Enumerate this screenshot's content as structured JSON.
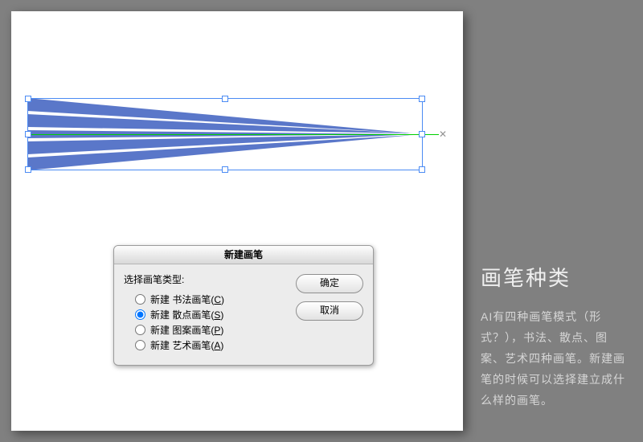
{
  "colors": {
    "shape_fill": "#5a77c9",
    "selection": "#4b8bf4",
    "axis": "#00d000"
  },
  "dialog": {
    "title": "新建画笔",
    "prompt": "选择画笔类型:",
    "options": [
      {
        "label_prefix": "新建 书法画笔(",
        "hotkey": "C",
        "label_suffix": ")",
        "selected": false
      },
      {
        "label_prefix": "新建 散点画笔(",
        "hotkey": "S",
        "label_suffix": ")",
        "selected": true
      },
      {
        "label_prefix": "新建 图案画笔(",
        "hotkey": "P",
        "label_suffix": ")",
        "selected": false
      },
      {
        "label_prefix": "新建 艺术画笔(",
        "hotkey": "A",
        "label_suffix": ")",
        "selected": false
      }
    ],
    "buttons": {
      "ok": "确定",
      "cancel": "取消"
    }
  },
  "sidebar": {
    "title": "画笔种类",
    "body": "AI有四种画笔模式（形式？），书法、散点、图案、艺术四种画笔。新建画笔的时候可以选择建立成什么样的画笔。"
  }
}
